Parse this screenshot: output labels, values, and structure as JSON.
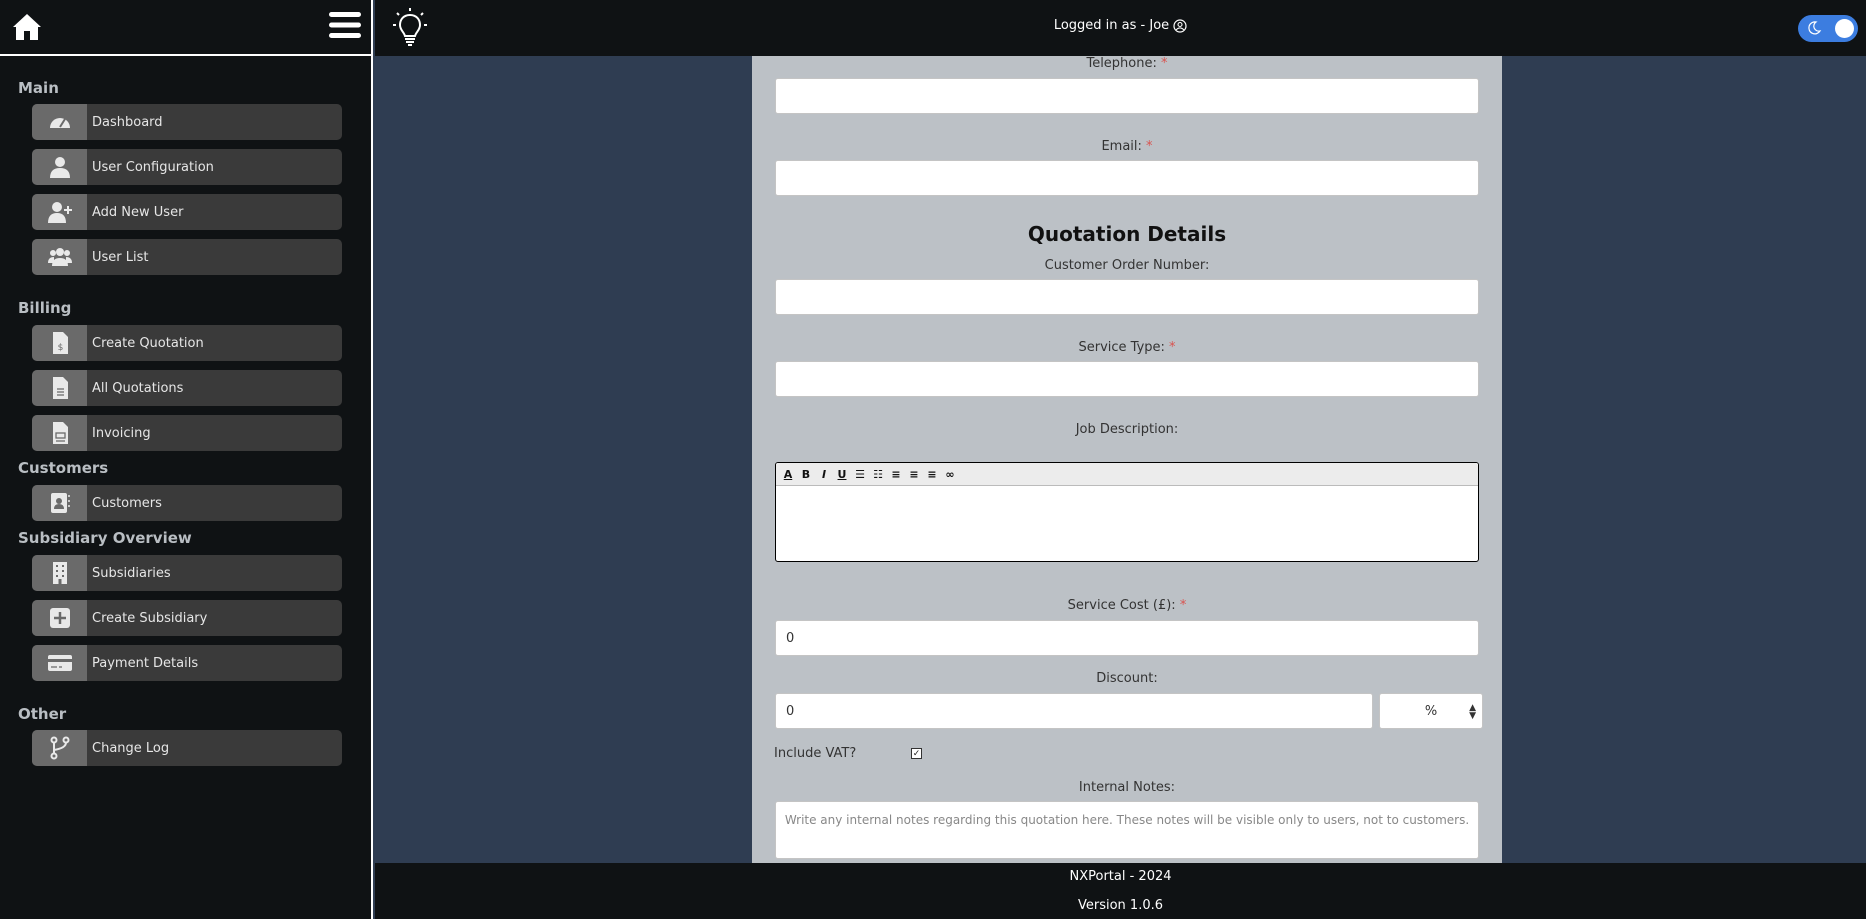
{
  "header": {
    "logged_in": "Logged in as - Joe"
  },
  "sidebar": {
    "sections": [
      {
        "title": "Main"
      },
      {
        "title": "Billing"
      },
      {
        "title": "Customers"
      },
      {
        "title": "Subsidiary Overview"
      },
      {
        "title": "Other"
      }
    ],
    "items": [
      {
        "label": "Dashboard",
        "icon": "gauge-icon"
      },
      {
        "label": "User Configuration",
        "icon": "user-icon"
      },
      {
        "label": "Add New User",
        "icon": "user-plus-icon"
      },
      {
        "label": "User List",
        "icon": "users-icon"
      },
      {
        "label": "Create Quotation",
        "icon": "invoice-dollar-icon"
      },
      {
        "label": "All Quotations",
        "icon": "document-icon"
      },
      {
        "label": "Invoicing",
        "icon": "invoice-icon"
      },
      {
        "label": "Customers",
        "icon": "address-book-icon"
      },
      {
        "label": "Subsidiaries",
        "icon": "building-icon"
      },
      {
        "label": "Create Subsidiary",
        "icon": "plus-square-icon"
      },
      {
        "label": "Payment Details",
        "icon": "credit-card-icon"
      },
      {
        "label": "Change Log",
        "icon": "code-branch-icon"
      }
    ]
  },
  "form": {
    "telephone_label": "Telephone:",
    "email_label": "Email:",
    "required_mark": "*",
    "section_title": "Quotation Details",
    "order_number_label": "Customer Order Number:",
    "service_type_label": "Service Type:",
    "job_description_label": "Job Description:",
    "service_cost_label": "Service Cost (£):",
    "service_cost_value": "0",
    "discount_label": "Discount:",
    "discount_value": "0",
    "discount_type": "%",
    "include_vat_label": "Include VAT?",
    "include_vat_checked": true,
    "internal_notes_label": "Internal Notes:",
    "internal_notes_placeholder": "Write any internal notes regarding this quotation here. These notes will be visible only to users, not to customers."
  },
  "footer": {
    "line1": "NXPortal - 2024",
    "line2": "Version 1.0.6"
  },
  "colors": {
    "sidebar_bg": "#0f1214",
    "content_bg": "#2f3d52",
    "panel_bg": "#bcc1c6",
    "toggle": "#3c7de0",
    "required": "#d9534f"
  }
}
